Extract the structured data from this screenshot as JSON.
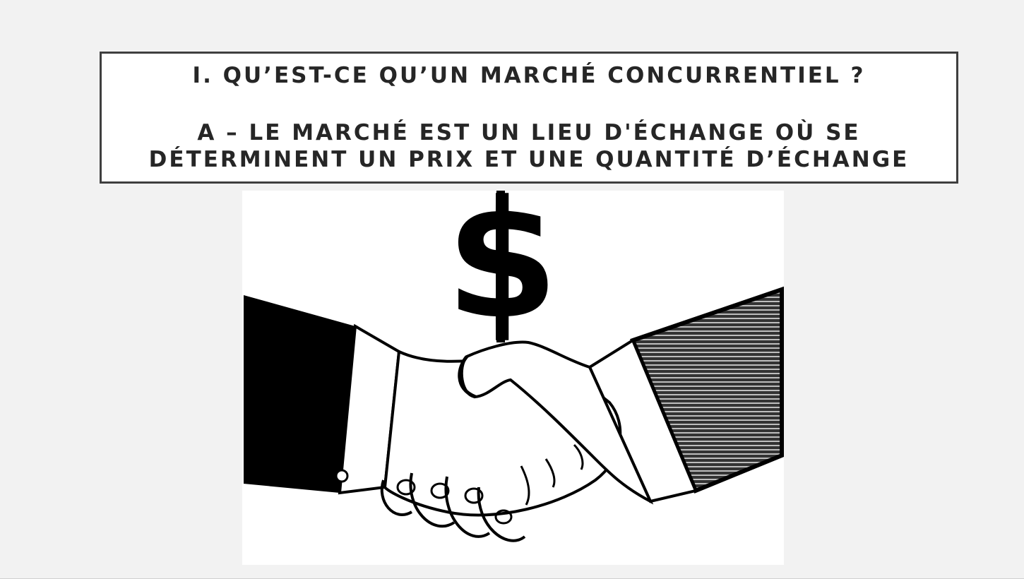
{
  "slide": {
    "title": "I. QU’EST-CE QU’UN MARCHÉ CONCURRENTIEL ?",
    "subtitle_line1": "A – LE MARCHÉ EST UN LIEU D'ÉCHANGE OÙ SE",
    "subtitle_line2": "DÉTERMINENT UN PRIX ET UNE QUANTITÉ D’ÉCHANGE"
  },
  "illustration": {
    "icon": "handshake-dollar-icon",
    "symbol": "$"
  },
  "colors": {
    "background": "#f2f2f2",
    "box_border": "#3f3f3f",
    "text": "#262626",
    "ink": "#000000"
  }
}
